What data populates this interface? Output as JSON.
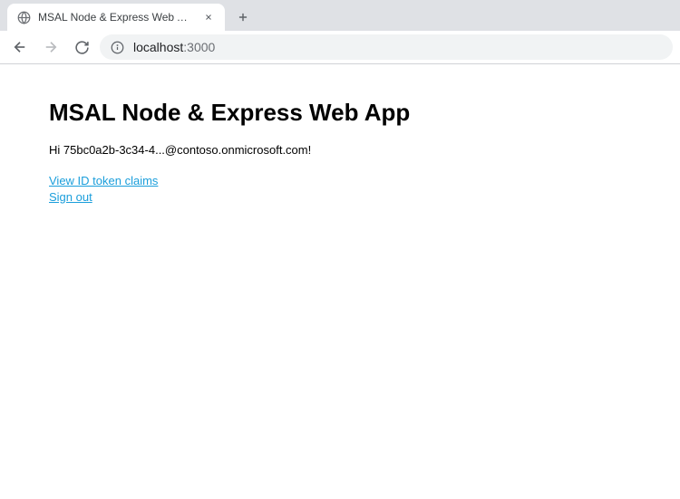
{
  "browser": {
    "tab": {
      "title": "MSAL Node & Express Web App",
      "favicon": "globe-icon"
    },
    "omnibox": {
      "host": "localhost",
      "port": ":3000"
    }
  },
  "page": {
    "heading": "MSAL Node & Express Web App",
    "greeting": "Hi 75bc0a2b-3c34-4...@contoso.onmicrosoft.com!",
    "links": {
      "view_claims": "View ID token claims",
      "sign_out": "Sign out"
    }
  }
}
